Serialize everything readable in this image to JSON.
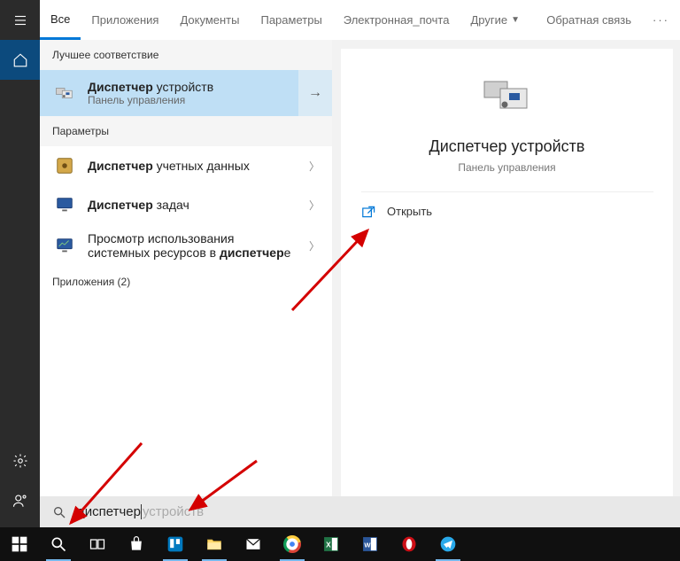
{
  "tabs": {
    "all": "Все",
    "apps": "Приложения",
    "docs": "Документы",
    "settings": "Параметры",
    "email": "Электронная_почта",
    "other": "Другие"
  },
  "feedback": "Обратная связь",
  "sections": {
    "best_match": "Лучшее соответствие",
    "params": "Параметры",
    "apps": "Приложения (2)"
  },
  "results": {
    "best": {
      "title_bold": "Диспетчер",
      "title_rest": " устройств",
      "sub": "Панель управления"
    },
    "r1": {
      "bold": "Диспетчер",
      "rest": " учетных данных"
    },
    "r2": {
      "bold": "Диспетчер",
      "rest": " задач"
    },
    "r3": {
      "line1": "Просмотр использования",
      "line2a": "системных ресурсов в ",
      "line2b": "диспетчер",
      "line2c": "е"
    }
  },
  "preview": {
    "title": "Диспетчер устройств",
    "sub": "Панель управления",
    "open": "Открыть"
  },
  "search": {
    "typed": "диспетчер",
    "suggest": " устройств"
  }
}
